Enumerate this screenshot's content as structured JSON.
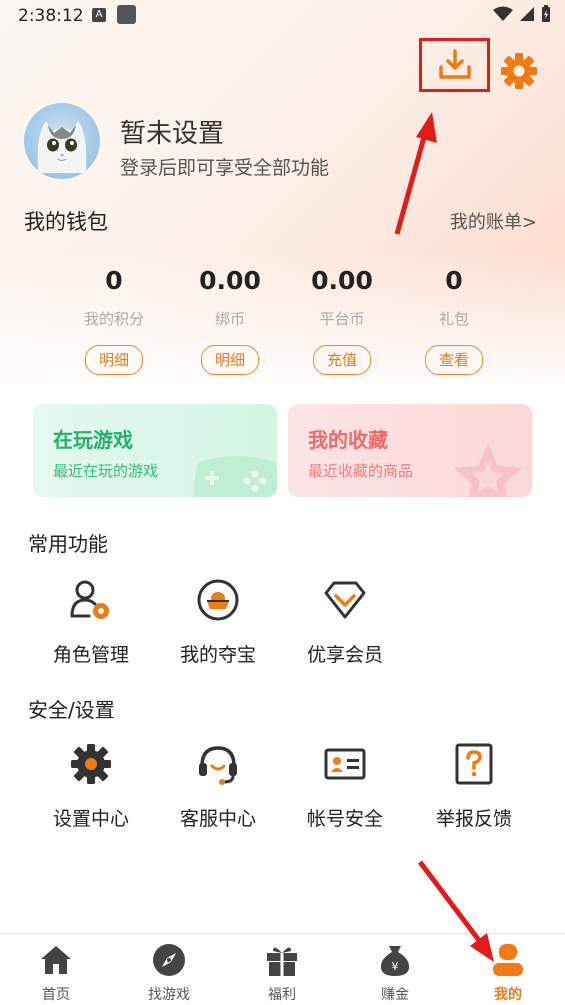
{
  "status": {
    "time": "2:38:12",
    "a_icon": "A"
  },
  "header": {
    "download_icon": "download-icon",
    "settings_icon": "gear-icon"
  },
  "profile": {
    "name": "暂未设置",
    "subtitle": "登录后即可享受全部功能"
  },
  "wallet": {
    "title": "我的钱包",
    "link": "我的账单>",
    "items": [
      {
        "value": "0",
        "label": "我的积分",
        "button": "明细"
      },
      {
        "value": "0.00",
        "label": "绑币",
        "button": "明细"
      },
      {
        "value": "0.00",
        "label": "平台币",
        "button": "充值"
      },
      {
        "value": "0",
        "label": "礼包",
        "button": "查看"
      }
    ]
  },
  "cards": {
    "playing": {
      "title": "在玩游戏",
      "subtitle": "最近在玩的游戏",
      "color": "#1fb26a"
    },
    "favorites": {
      "title": "我的收藏",
      "subtitle": "最近收藏的商品",
      "color": "#ef6a6a"
    }
  },
  "common": {
    "title": "常用功能",
    "items": [
      {
        "label": "角色管理",
        "icon": "role-icon"
      },
      {
        "label": "我的夺宝",
        "icon": "treasure-icon"
      },
      {
        "label": "优享会员",
        "icon": "diamond-icon"
      }
    ]
  },
  "security": {
    "title": "安全/设置",
    "items": [
      {
        "label": "设置中心",
        "icon": "gear-icon"
      },
      {
        "label": "客服中心",
        "icon": "headset-icon"
      },
      {
        "label": "帐号安全",
        "icon": "id-card-icon"
      },
      {
        "label": "举报反馈",
        "icon": "question-icon"
      }
    ]
  },
  "tabs": [
    {
      "label": "首页",
      "icon": "home-icon"
    },
    {
      "label": "找游戏",
      "icon": "compass-icon"
    },
    {
      "label": "福利",
      "icon": "gift-icon"
    },
    {
      "label": "赚金",
      "icon": "money-bag-icon"
    },
    {
      "label": "我的",
      "icon": "user-icon",
      "active": true
    }
  ],
  "colors": {
    "accent": "#f07b12",
    "highlight": "#e21b1b",
    "icon_dark": "#333333"
  }
}
